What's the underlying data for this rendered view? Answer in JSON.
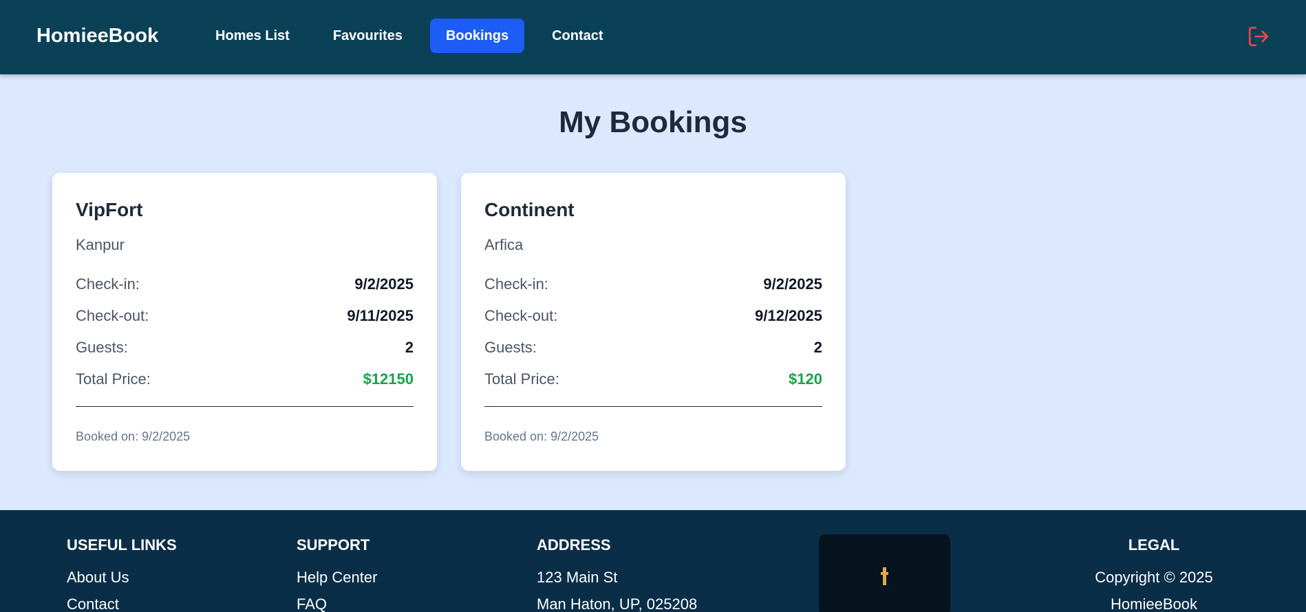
{
  "nav": {
    "brand": "HomieeBook",
    "links": [
      {
        "label": "Homes List",
        "active": false
      },
      {
        "label": "Favourites",
        "active": false
      },
      {
        "label": "Bookings",
        "active": true
      },
      {
        "label": "Contact",
        "active": false
      }
    ],
    "logout_icon": "logout-icon",
    "logout_color": "#ef4444"
  },
  "page_title": "My Bookings",
  "bookings": [
    {
      "name": "VipFort",
      "location": "Kanpur",
      "checkin_label": "Check-in:",
      "checkin": "9/2/2025",
      "checkout_label": "Check-out:",
      "checkout": "9/11/2025",
      "guests_label": "Guests:",
      "guests": "2",
      "price_label": "Total Price:",
      "price": "$12150",
      "booked_on": "Booked on: 9/2/2025"
    },
    {
      "name": "Continent",
      "location": "Arfica",
      "checkin_label": "Check-in:",
      "checkin": "9/2/2025",
      "checkout_label": "Check-out:",
      "checkout": "9/12/2025",
      "guests_label": "Guests:",
      "guests": "2",
      "price_label": "Total Price:",
      "price": "$120",
      "booked_on": "Booked on: 9/2/2025"
    }
  ],
  "footer": {
    "useful_links": {
      "heading": "USEFUL LINKS",
      "items": [
        "About Us",
        "Contact"
      ]
    },
    "support": {
      "heading": "SUPPORT",
      "items": [
        "Help Center",
        "FAQ"
      ]
    },
    "address": {
      "heading": "ADDRESS",
      "lines": [
        "123 Main St",
        "Man Haton, UP, 025208"
      ]
    },
    "legal": {
      "heading": "LEGAL",
      "lines": [
        "Copyright © 2025",
        "HomieeBook"
      ]
    }
  },
  "colors": {
    "nav_bg": "#0a4157",
    "page_bg": "#dbe8fe",
    "accent": "#1d5cf6",
    "price": "#16a34a",
    "footer_bg": "#0a2e48"
  }
}
